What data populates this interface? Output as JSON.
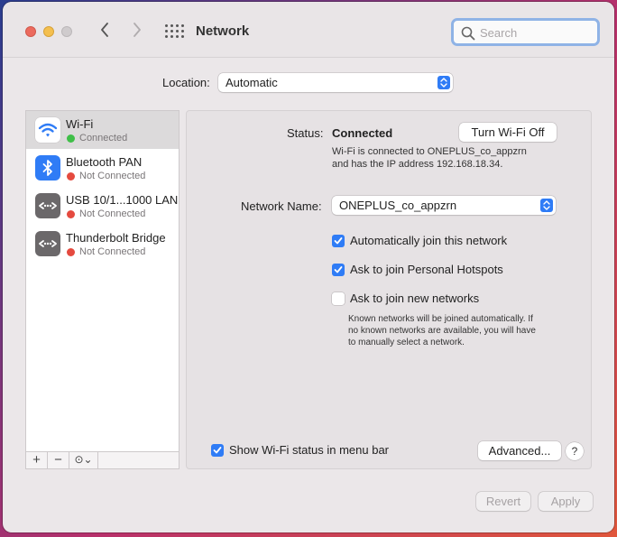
{
  "window": {
    "title": "Network",
    "search": {
      "placeholder": "Search",
      "value": ""
    }
  },
  "location": {
    "label": "Location:",
    "value": "Automatic"
  },
  "services": [
    {
      "name": "Wi-Fi",
      "status": "Connected",
      "status_color": "#3fbf48",
      "icon": "wifi-icon",
      "selected": true
    },
    {
      "name": "Bluetooth PAN",
      "status": "Not Connected",
      "status_color": "#e54a3f",
      "icon": "bluetooth-icon"
    },
    {
      "name": "USB 10/1...1000 LAN",
      "status": "Not Connected",
      "status_color": "#e54a3f",
      "icon": "ethernet-icon"
    },
    {
      "name": "Thunderbolt Bridge",
      "status": "Not Connected",
      "status_color": "#e54a3f",
      "icon": "ethernet-icon"
    }
  ],
  "sidebar_tools": {
    "add": "+",
    "remove": "−",
    "action": "⊙⌄"
  },
  "detail": {
    "status_label": "Status:",
    "status_value": "Connected",
    "turn_off_button": "Turn Wi-Fi Off",
    "status_desc_line1": "Wi-Fi is connected to ONEPLUS_co_appzrn",
    "status_desc_line2": "and has the IP address 192.168.18.34.",
    "network_name_label": "Network Name:",
    "network_name_value": "ONEPLUS_co_appzrn",
    "options": [
      {
        "label": "Automatically join this network",
        "checked": true
      },
      {
        "label": "Ask to join Personal Hotspots",
        "checked": true
      },
      {
        "label": "Ask to join new networks",
        "checked": false
      }
    ],
    "known_desc_line1": "Known networks will be joined automatically. If",
    "known_desc_line2": "no known networks are available, you will have",
    "known_desc_line3": "to manually select a network.",
    "show_status_label": "Show Wi-Fi status in menu bar",
    "show_status_checked": true,
    "advanced_button": "Advanced...",
    "help_button": "?"
  },
  "footer": {
    "revert_button": "Revert",
    "apply_button": "Apply"
  },
  "colors": {
    "accent": "#2f7cf6",
    "connected": "#3fbf48",
    "not_connected": "#e54a3f"
  }
}
